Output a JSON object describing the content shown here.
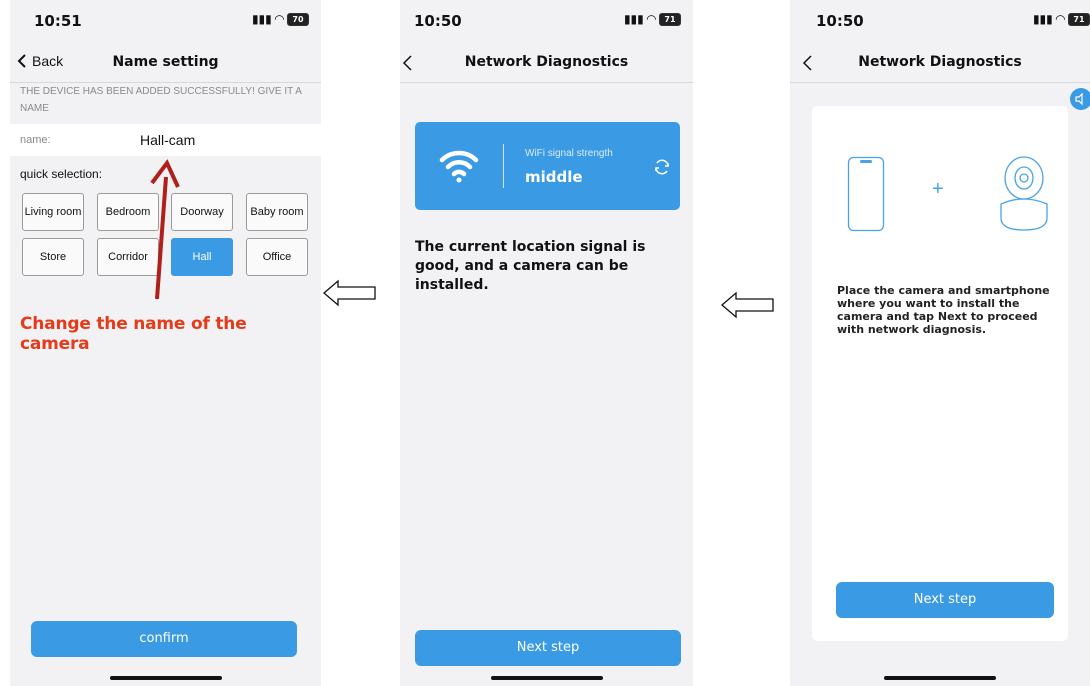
{
  "screens": [
    {
      "time": "10:51",
      "battery": "70",
      "title": "Name setting",
      "back_label": "Back",
      "banner": "THE DEVICE HAS BEEN ADDED SUCCESSFULLY! GIVE IT A NAME",
      "name_label": "name:",
      "name_value": "Hall-cam",
      "quick_label": "quick selection:",
      "chips": [
        "Living room",
        "Bedroom",
        "Doorway",
        "Baby room",
        "Store",
        "Corridor",
        "Hall",
        "Office"
      ],
      "selected_chip": "Hall",
      "annotation": "Change the name of the camera",
      "confirm_label": "confirm"
    },
    {
      "time": "10:50",
      "battery": "71",
      "title": "Network Diagnostics",
      "wifi_label": "WiFi signal strength",
      "wifi_value": "middle",
      "message": "The current location signal is good, and a camera can be installed.",
      "next_label": "Next step"
    },
    {
      "time": "10:50",
      "battery": "71",
      "title": "Network Diagnostics",
      "plus": "+",
      "description": "Place the camera and smartphone where you want to install the camera and tap Next to proceed with network diagnosis.",
      "next_label": "Next step"
    }
  ],
  "colors": {
    "accent": "#3a9be4",
    "annotation": "#e63b1a",
    "annotation_arrow": "#b0201a"
  }
}
